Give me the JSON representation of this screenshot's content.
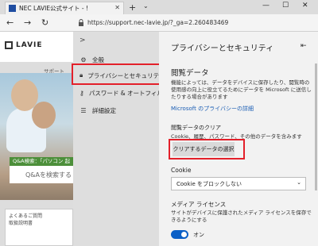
{
  "browser": {
    "tab_title": "NEC LAVIE公式サイト - !",
    "tab_close": "✕",
    "new_tab": "+",
    "tab_menu": "⌄",
    "minimize": "—",
    "maximize": "☐",
    "close": "✕",
    "back": "←",
    "forward": "→",
    "refresh": "↻",
    "url": "https://support.nec-lavie.jp/?_ga=2.260483469"
  },
  "website": {
    "logo": "LAVIE",
    "nav_support": "サポート",
    "qa_banner": "Q&A検索：「パソコン 起",
    "search_placeholder": "Q&Aを検索する",
    "faq_lines": [
      "よくあるご質問",
      "取扱説明書"
    ]
  },
  "settings_menu": {
    "chevron": ">",
    "items": [
      {
        "label": "全般",
        "icon": "gear-icon"
      },
      {
        "label": "プライバシーとセキュリティ",
        "icon": "lock-icon"
      },
      {
        "label": "パスワード & オートフィル",
        "icon": "key-icon"
      },
      {
        "label": "詳細設定",
        "icon": "sliders-icon"
      }
    ]
  },
  "panel": {
    "title": "プライバシーとセキュリティ",
    "pin": "⇤",
    "browsing_data_title": "閲覧データ",
    "browsing_data_desc": "機能によっては、データをデバイスに保存したり、閲覧時の使用感の向上に役立てるためにデータを Microsoft に送信したりする場合があります",
    "privacy_link": "Microsoft のプライバシーの詳細",
    "clear_title": "閲覧データのクリア",
    "clear_desc": "Cookie、履歴、パスワード、その他のデータを含みます",
    "clear_button": "クリアするデータの選択",
    "cookie_title": "Cookie",
    "cookie_value": "Cookie をブロックしない",
    "media_title": "メディア ライセンス",
    "media_desc": "サイトがデバイスに保護されたメディア ライセンスを保存できるようにする",
    "media_toggle_label": "オン"
  },
  "colors": {
    "highlight": "#e3202a",
    "toggle_on": "#0b5fc6",
    "link": "#1a5db4"
  }
}
